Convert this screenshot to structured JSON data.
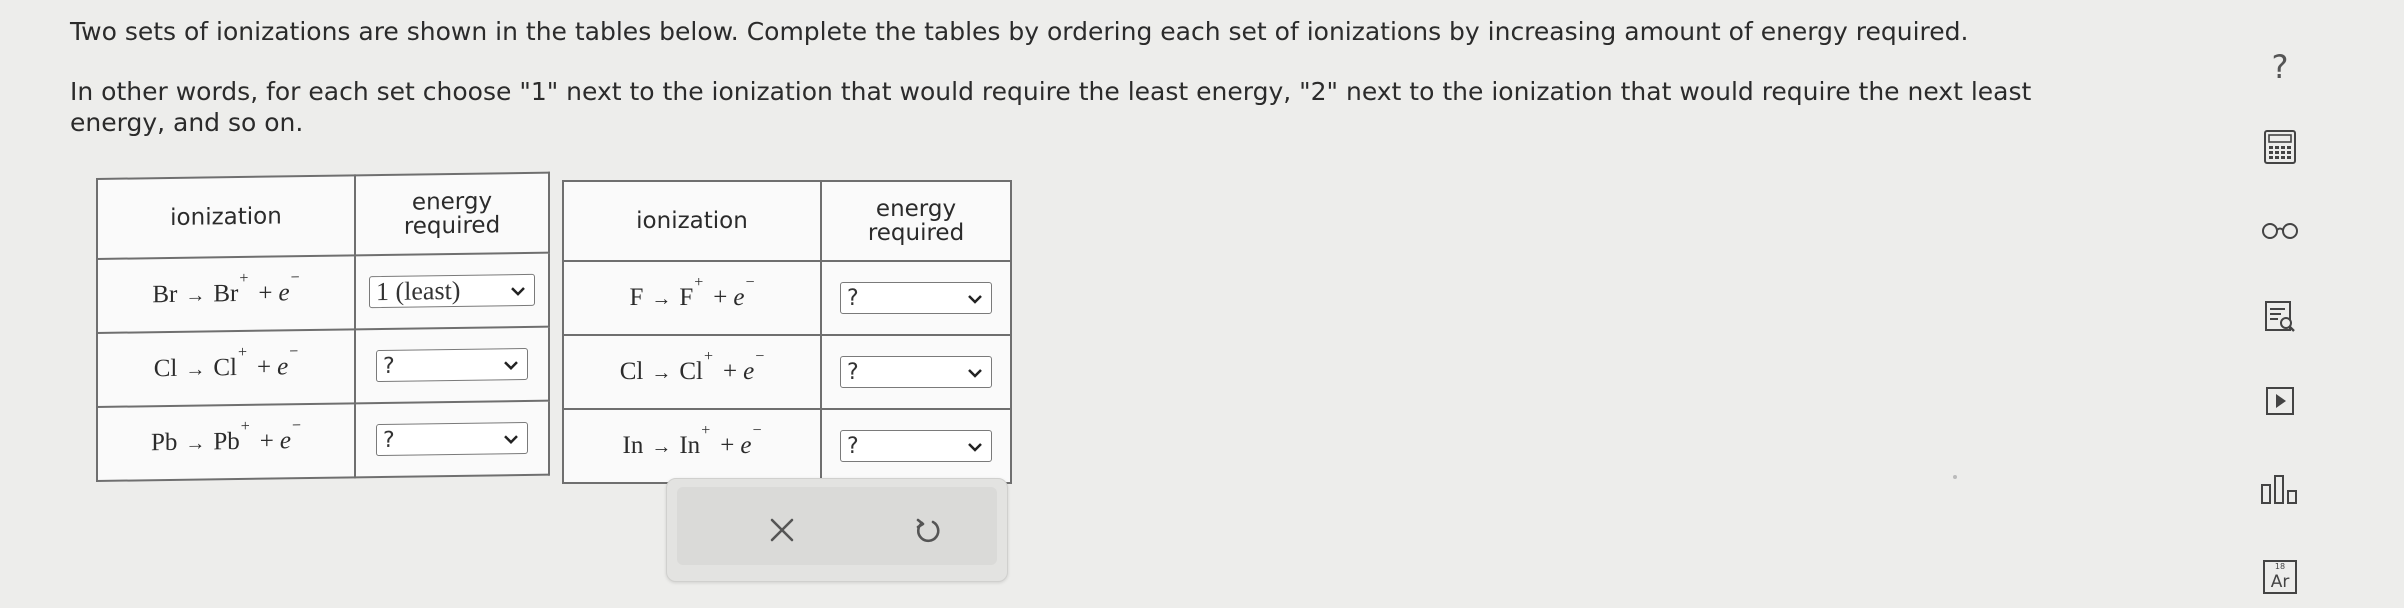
{
  "instructions": {
    "line1": "Two sets of ionizations are shown in the tables below. Complete the tables by ordering each set of ionizations by increasing amount of energy required.",
    "line2": "In other words, for each set choose \"1\" next to the ionization that would require the least energy, \"2\" next to the ionization that would require the next least energy, and so on."
  },
  "tables": [
    {
      "header_ionization": "ionization",
      "header_energy": "energy required",
      "rows": [
        {
          "reactant": "Br",
          "arrow": "→",
          "product": "Br",
          "charge": "+",
          "plus": "+",
          "electron": "e",
          "electron_charge": "−",
          "selection": "1 (least)"
        },
        {
          "reactant": "Cl",
          "arrow": "→",
          "product": "Cl",
          "charge": "+",
          "plus": "+",
          "electron": "e",
          "electron_charge": "−",
          "selection": "?"
        },
        {
          "reactant": "Pb",
          "arrow": "→",
          "product": "Pb",
          "charge": "+",
          "plus": "+",
          "electron": "e",
          "electron_charge": "−",
          "selection": "?"
        }
      ]
    },
    {
      "header_ionization": "ionization",
      "header_energy": "energy required",
      "rows": [
        {
          "reactant": "F",
          "arrow": "→",
          "product": "F",
          "charge": "+",
          "plus": "+",
          "electron": "e",
          "electron_charge": "−",
          "selection": "?"
        },
        {
          "reactant": "Cl",
          "arrow": "→",
          "product": "Cl",
          "charge": "+",
          "plus": "+",
          "electron": "e",
          "electron_charge": "−",
          "selection": "?"
        },
        {
          "reactant": "In",
          "arrow": "→",
          "product": "In",
          "charge": "+",
          "plus": "+",
          "electron": "e",
          "electron_charge": "−",
          "selection": "?"
        }
      ]
    }
  ],
  "actions": {
    "clear_icon": "close-icon",
    "undo_icon": "undo-icon"
  },
  "sidebar": {
    "help_label": "?",
    "items": [
      {
        "icon": "calculator-icon"
      },
      {
        "icon": "glasses-icon"
      },
      {
        "icon": "document-search-icon"
      },
      {
        "icon": "video-play-icon"
      },
      {
        "icon": "bar-chart-icon"
      },
      {
        "icon": "periodic-table-icon",
        "label": "Ar",
        "number": "18"
      }
    ]
  },
  "colors": {
    "background": "#ededeb",
    "table_border": "#6f6f6f",
    "text": "#2b2b2b"
  }
}
